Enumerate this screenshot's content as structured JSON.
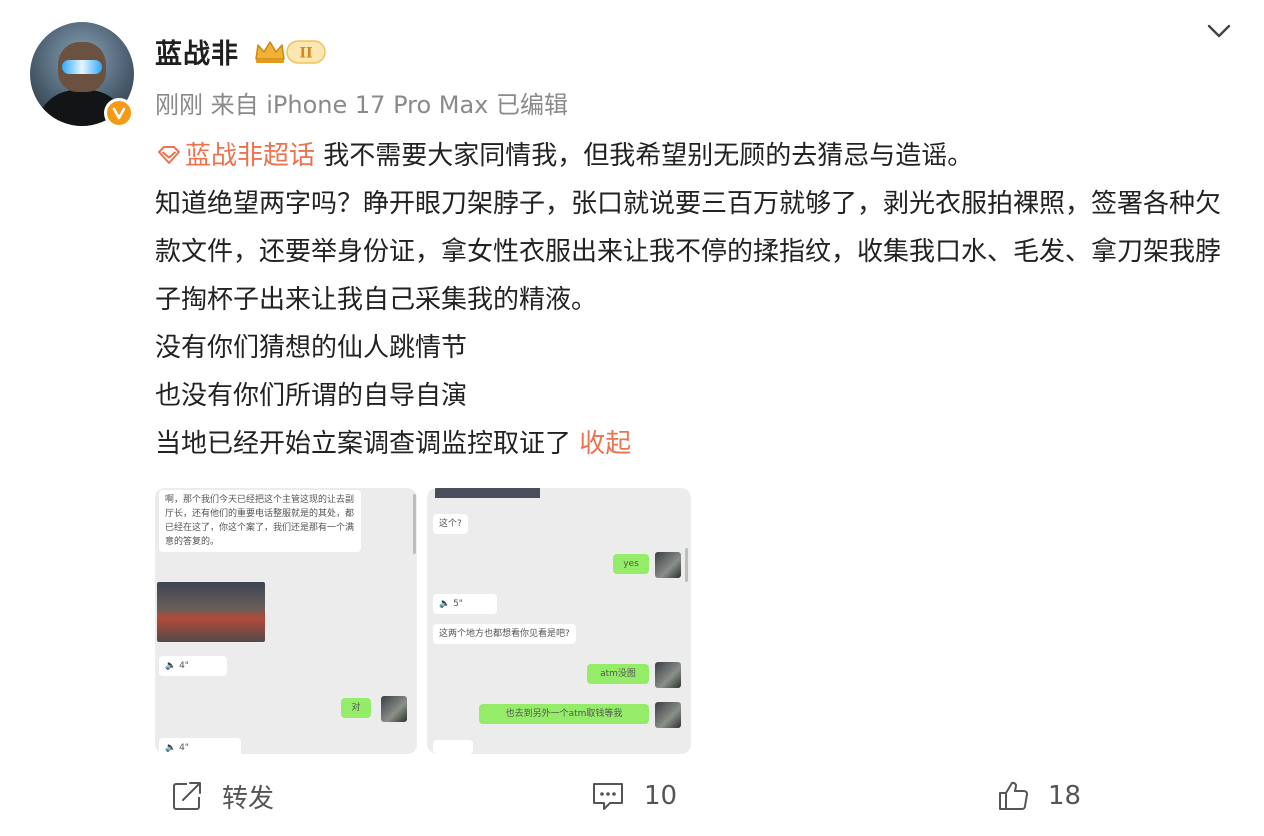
{
  "post": {
    "username": "蓝战非",
    "meta": "刚刚 来自 iPhone 17 Pro Max 已编辑",
    "badge_level": "II",
    "supertopic": "蓝战非超话",
    "paragraphs": [
      "我不需要大家同情我，但我希望别无顾的去猜忌与造谣。",
      "知道绝望两字吗？睁开眼刀架脖子，张口就说要三百万就够了，剥光衣服拍裸照，签署各种欠款文件，还要举身份证，拿女性衣服出来让我不停的揉指纹，收集我口水、毛发、拿刀架我脖子掏杯子出来让我自己采集我的精液。",
      "没有你们猜想的仙人跳情节",
      "也没有你们所谓的自导自演",
      "当地已经开始立案调查调监控取证了"
    ],
    "collapse_label": "收起"
  },
  "images": {
    "shot1": {
      "message": "啊，那个我们今天已经把这个主管这现的让去副厅长，还有他们的重要电话整服就是的其处，都已经在这了，你这个案了，我们还是那有一个满意的答复的。",
      "voice1": "4\"",
      "reply": "对",
      "voice2": "4\""
    },
    "shot2": {
      "question": "这个?",
      "yes": "yes",
      "voice": "5\"",
      "ask": "这两个地方也都想看你见看是吧?",
      "reply1": "atm没图",
      "reply2": "也去到另外一个atm取钱等我"
    }
  },
  "actions": {
    "repost_label": "转发",
    "comment_count": "10",
    "like_count": "18"
  },
  "colors": {
    "accent": "#eb7350",
    "verify": "#f59a12",
    "chat_green": "#95ec69"
  },
  "icons": {
    "verify": "verified-v-icon",
    "crown": "crown-badge-icon",
    "chevron": "chevron-down-icon",
    "supertopic": "diamond-icon",
    "repost": "share-icon",
    "comment": "comment-icon",
    "like": "thumbs-up-icon"
  }
}
